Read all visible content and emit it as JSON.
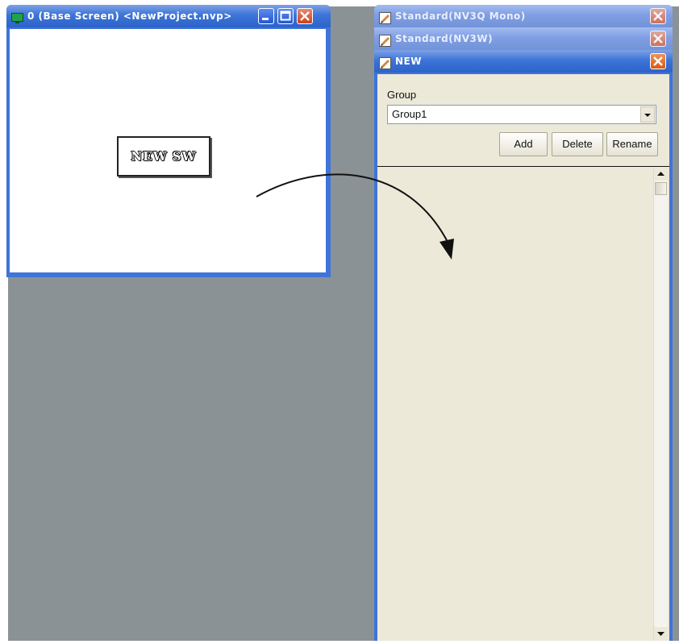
{
  "screen_window": {
    "title": "0 (Base Screen) <NewProject.nvp>",
    "icon": "monitor-icon",
    "controls": [
      "minimize-icon",
      "maximize-icon",
      "close-icon"
    ],
    "switch_label": "NEW SW"
  },
  "palette": {
    "collapsed_panels": [
      {
        "title": "Standard(NV3Q Mono)",
        "icon": "parts-palette-icon"
      },
      {
        "title": "Standard(NV3W)",
        "icon": "parts-palette-icon"
      }
    ],
    "active_panel": {
      "title": "NEW",
      "icon": "parts-palette-icon",
      "group_label": "Group",
      "group_selected": "Group1",
      "buttons": {
        "add": "Add",
        "delete": "Delete",
        "rename": "Rename"
      }
    }
  },
  "colors": {
    "desktop": "#8b9296",
    "titlebar": "#3c74d8",
    "panel": "#ece9d8",
    "close_button": "#c9421d"
  }
}
